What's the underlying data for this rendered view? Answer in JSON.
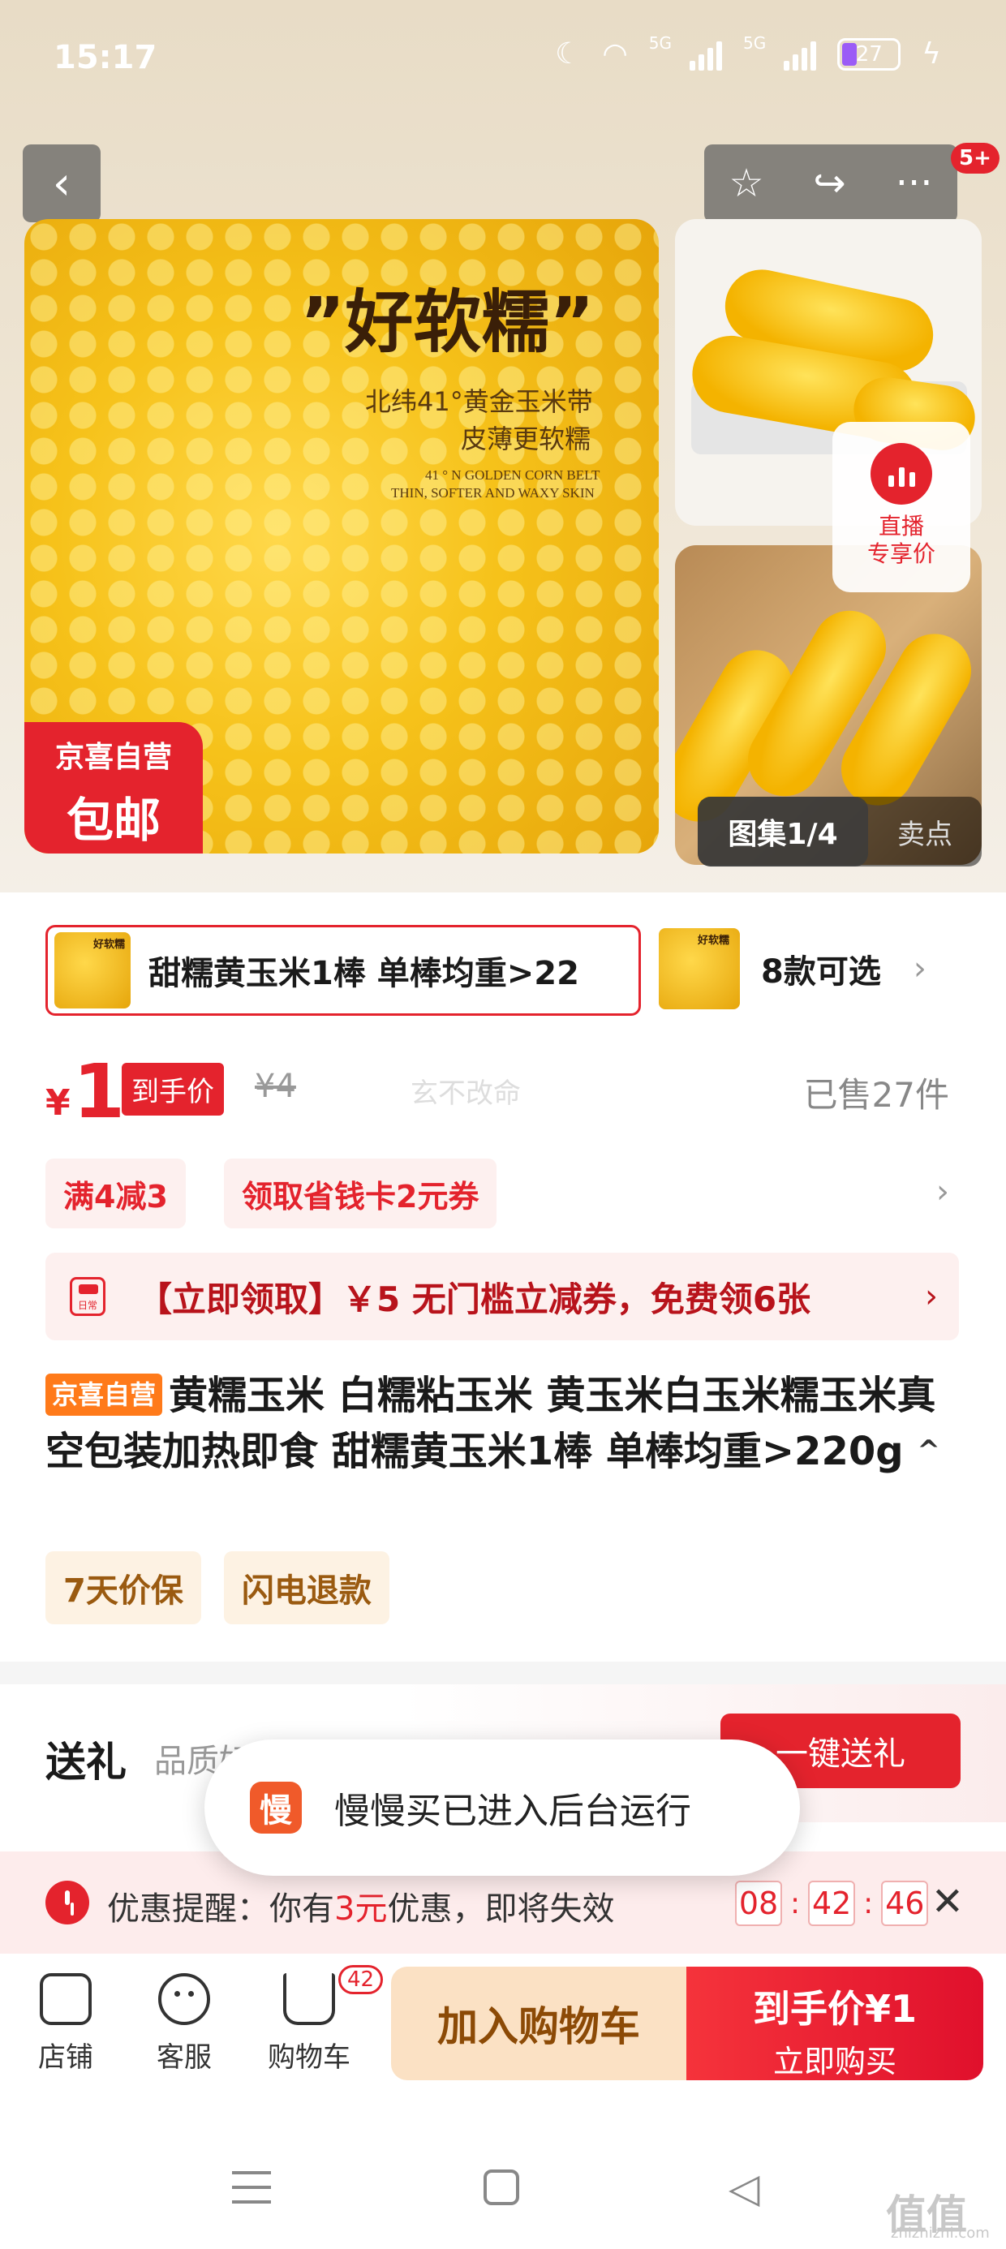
{
  "status_bar": {
    "time": "15:17",
    "net1": "5G",
    "net2": "5G",
    "battery": "27"
  },
  "nav": {
    "back": "‹",
    "star": "☆",
    "share": "↪",
    "more": "···",
    "badge": "5+"
  },
  "main_image": {
    "title": "”好软糯”",
    "sub1": "北纬41°黄金玉米带",
    "sub2": "皮薄更软糯",
    "en1": "41 ° N GOLDEN CORN BELT",
    "en2": "THIN, SOFTER AND WAXY SKIN",
    "badge_line1": "京喜自营",
    "badge_line2": "包邮"
  },
  "live": {
    "label_line1": "直播",
    "label_line2": "专享价"
  },
  "gallery": {
    "counter": "图集1/4",
    "selling_points": "卖点"
  },
  "sku": {
    "selected": "甜糯黄玉米1棒 单棒均重>22",
    "thumb_label": "好软糯",
    "count": "8款可选",
    "chevron": "›"
  },
  "price": {
    "currency": "¥",
    "value": "1",
    "tag": "到手价",
    "original": "¥4",
    "watermark": "玄不改命",
    "sold": "已售27件"
  },
  "promos": {
    "tag1": "满4减3",
    "tag2": "领取省钱卡2元券",
    "chevron": "›"
  },
  "coupon": {
    "icon_text": "日常",
    "text": "【立即领取】￥5 无门槛立减券，免费领6张",
    "chevron": "›"
  },
  "product": {
    "tag": "京喜自营",
    "title": "黄糯玉米 白糯粘玉米 黄玉米白玉米糯玉米真空包装加热即食 甜糯黄玉米1棒 单棒均重>220g",
    "caret": "^"
  },
  "services": [
    "7天价保",
    "闪电退款"
  ],
  "gift": {
    "title": "送礼",
    "subtitle": "品质好物 心意送达",
    "button": "一键送礼"
  },
  "toast": {
    "icon": "慢",
    "text": "慢慢买已进入后台运行"
  },
  "reminder": {
    "prefix": "优惠提醒：你有",
    "amount": "3元",
    "suffix": "优惠，即将失效",
    "hh": "08",
    "mm": "42",
    "ss": "46",
    "sep": ":",
    "close": "✕"
  },
  "bottom_bar": {
    "shop": "店铺",
    "service": "客服",
    "cart": "购物车",
    "cart_count": "42",
    "add_cart": "加入购物车",
    "buy_line1": "到手价¥1",
    "buy_line2": "立即购买"
  },
  "watermark": {
    "logo": "值值值",
    "site": "zhizhizhi.com"
  },
  "colors": {
    "accent": "#e4232d",
    "orange_tag": "#ff7a1a",
    "cart_btn": "#fbe1c4"
  }
}
